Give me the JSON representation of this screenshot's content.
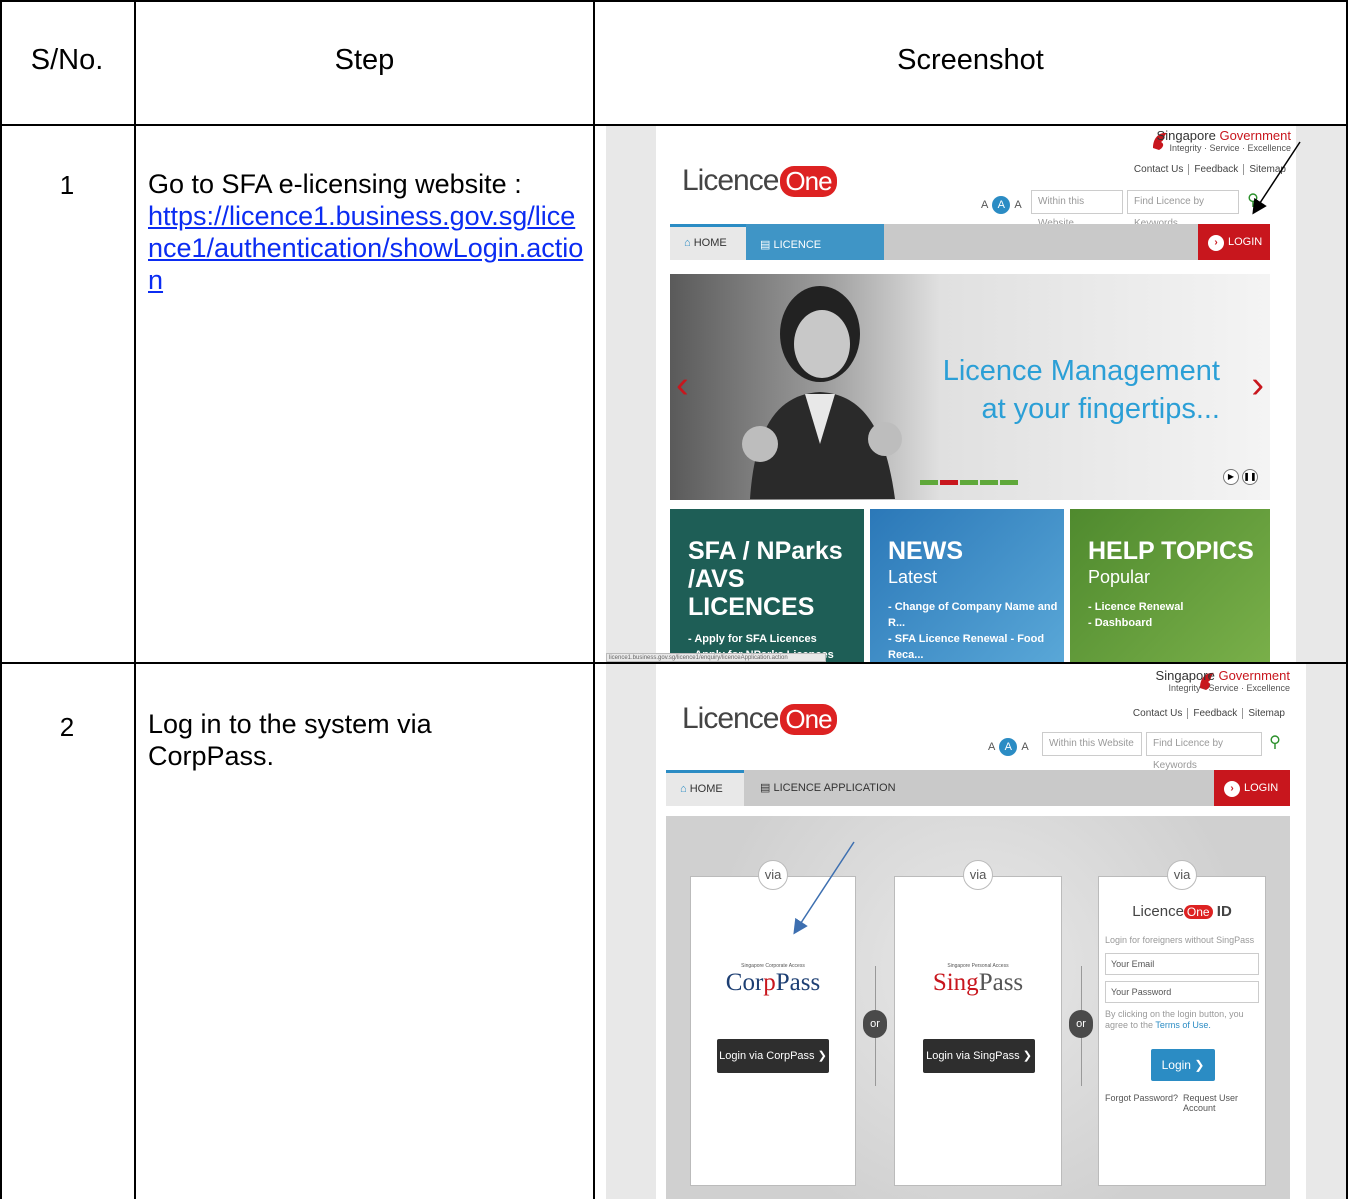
{
  "table": {
    "headers": {
      "sno": "S/No.",
      "step": "Step",
      "screenshot": "Screenshot"
    },
    "rows": [
      {
        "num": "1",
        "step_text": "Go to SFA e-licensing website :",
        "step_link": "https://licence1.business.gov.sg/licence1/authentication/showLogin.action"
      },
      {
        "num": "2",
        "step_text": "Log in to the system via CorpPass."
      }
    ]
  },
  "shot1": {
    "gov_title_a": "Singapore",
    "gov_title_b": "Government",
    "gov_sub": "Integrity · Service · Excellence",
    "links": [
      "Contact Us",
      "Feedback",
      "Sitemap"
    ],
    "logo_a": "Licence",
    "logo_b": "One",
    "font_sizes": [
      "A",
      "A",
      "A"
    ],
    "scope_select": "Within this Website",
    "search_placeholder": "Find Licence by Keywords",
    "nav_home": "HOME",
    "nav_licapp": "LICENCE APPLICATION",
    "nav_login": "LOGIN",
    "hero_line1": "Licence Management",
    "hero_line2": "at your fingertips...",
    "tiles": [
      {
        "title1": "SFA / NParks",
        "title2": "/AVS LICENCES",
        "sub": "",
        "items": [
          "Apply for SFA Licences",
          "Apply for NParks Licences"
        ],
        "color": "#1e5e56"
      },
      {
        "title1": "NEWS",
        "title2": "",
        "sub": "Latest",
        "items": [
          "Change of Company Name and R...",
          "SFA Licence Renewal - Food Reca..."
        ],
        "color": "#2b78b8"
      },
      {
        "title1": "HELP TOPICS",
        "title2": "",
        "sub": "Popular",
        "items": [
          "Licence Renewal",
          "Dashboard"
        ],
        "color": "#4f8a2e"
      }
    ],
    "status_url": "licence1.business.gov.sg/licence1/enquiry/licenceApplication.action"
  },
  "shot2": {
    "gov_title_a": "Singapore",
    "gov_title_b": "Government",
    "gov_sub": "Integrity · Service · Excellence",
    "links": [
      "Contact Us",
      "Feedback",
      "Sitemap"
    ],
    "logo_a": "Licence",
    "logo_b": "One",
    "font_sizes": [
      "A",
      "A",
      "A"
    ],
    "scope_select": "Within this Website",
    "search_placeholder": "Find Licence by Keywords",
    "nav_home": "HOME",
    "nav_licapp": "LICENCE APPLICATION",
    "nav_login": "LOGIN",
    "via": "via",
    "or": "or",
    "corppass_small": "Singapore Corporate Access",
    "corppass_a": "Cor",
    "corppass_b": "p",
    "corppass_c": "Pass",
    "corppass_btn": "Login via CorpPass",
    "singpass_small": "Singapore Personal Access",
    "singpass_a": "S",
    "singpass_b": "ing",
    "singpass_c": "Pass",
    "singpass_btn": "Login via SingPass",
    "lid_logo_a": "Licence",
    "lid_logo_b": "One",
    "lid_logo_c": "ID",
    "lid_note": "Login for foreigners without SingPass",
    "email_placeholder": "Your Email",
    "password_placeholder": "Your Password",
    "terms_text": "By clicking on the login button, you agree to",
    "terms_pre": "the",
    "terms_link": "Terms of Use.",
    "login_btn": "Login",
    "forgot": "Forgot Password?",
    "request": "Request User Account"
  }
}
